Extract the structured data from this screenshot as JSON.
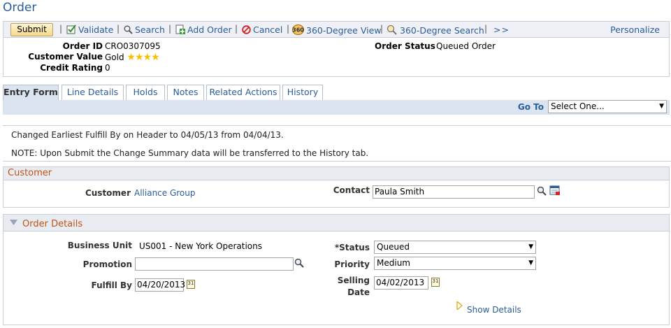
{
  "page": {
    "title": "Order"
  },
  "toolbar": {
    "submit_label": "Submit",
    "validate_label": "Validate",
    "search_label": "Search",
    "add_order_label": "Add Order",
    "cancel_label": "Cancel",
    "view360_label": "360-Degree View",
    "search360_label": "360-Degree Search",
    "more_label": ">>",
    "personalize_label": "Personalize",
    "separator": "|"
  },
  "header": {
    "order_id_label": "Order ID",
    "order_id_value": "CRO0307095",
    "customer_value_label": "Customer Value",
    "customer_value_value": "Gold",
    "customer_value_stars": 4,
    "credit_rating_label": "Credit Rating",
    "credit_rating_value": "0",
    "order_status_label": "Order Status",
    "order_status_value": "Queued Order"
  },
  "tabs": [
    {
      "label": "Entry Form"
    },
    {
      "label": "Line Details"
    },
    {
      "label": "Holds"
    },
    {
      "label": "Notes"
    },
    {
      "label": "Related Actions"
    },
    {
      "label": "History"
    }
  ],
  "goto": {
    "label": "Go To",
    "selected": "Select One..."
  },
  "messages": {
    "line1": "Changed Earliest Fulfill By on Header to 04/05/13 from 04/04/13.",
    "line2": "NOTE:  Upon Submit the Change Summary data will be transferred to the History tab."
  },
  "customer": {
    "section_title": "Customer",
    "customer_label": "Customer",
    "customer_value": "Alliance Group",
    "contact_label": "Contact",
    "contact_value": "Paula Smith"
  },
  "order_details": {
    "section_title": "Order Details",
    "business_unit_label": "Business Unit",
    "business_unit_value": "US001 - New York Operations",
    "promotion_label": "Promotion",
    "promotion_value": "",
    "fulfill_by_label": "Fulfill By",
    "fulfill_by_value": "04/20/2013",
    "status_label": "*Status",
    "status_value": "Queued",
    "priority_label": "Priority",
    "priority_value": "Medium",
    "selling_date_label_1": "Selling",
    "selling_date_label_2": "Date",
    "selling_date_value": "04/02/2013",
    "show_details_label": "Show Details",
    "calendar_glyph": "31"
  },
  "colors": {
    "link": "#2b5d9a",
    "section_title": "#c0531a",
    "tab_active_bg": "#dbe4f1",
    "star": "#f2c200"
  }
}
